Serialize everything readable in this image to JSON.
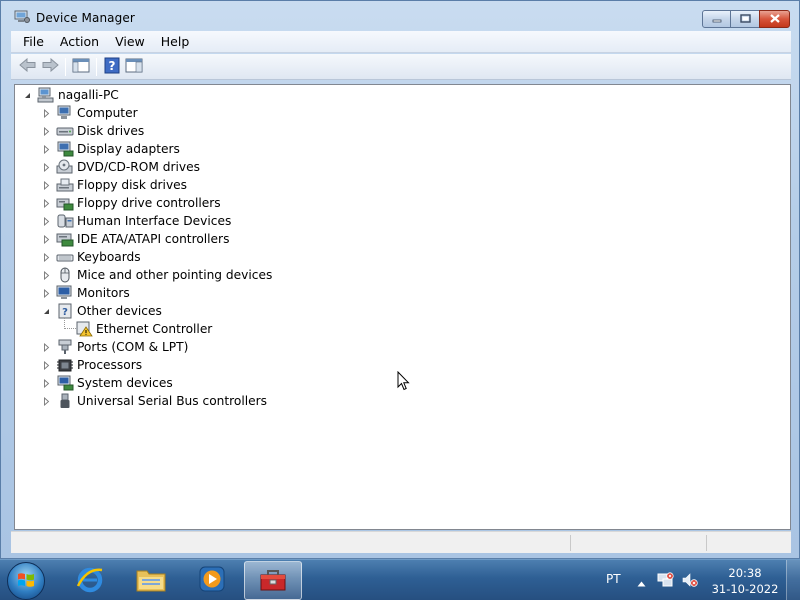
{
  "window": {
    "title": "Device Manager",
    "icon": "device-manager-icon",
    "caption_buttons": [
      "minimize",
      "maximize",
      "close"
    ]
  },
  "menu": [
    "File",
    "Action",
    "View",
    "Help"
  ],
  "toolbar": {
    "buttons": [
      "back-arrow-icon",
      "forward-arrow-icon",
      "show-hide-console-tree-icon",
      "help-icon",
      "show-action-pane-icon"
    ]
  },
  "tree": {
    "root": {
      "label": "nagalli-PC",
      "icon": "computer-network-icon",
      "expanded": true
    },
    "categories": [
      {
        "label": "Computer",
        "icon": "computer-icon",
        "expanded": false
      },
      {
        "label": "Disk drives",
        "icon": "disk-drive-icon",
        "expanded": false
      },
      {
        "label": "Display adapters",
        "icon": "display-adapter-icon",
        "expanded": false
      },
      {
        "label": "DVD/CD-ROM drives",
        "icon": "dvd-drive-icon",
        "expanded": false
      },
      {
        "label": "Floppy disk drives",
        "icon": "floppy-disk-icon",
        "expanded": false
      },
      {
        "label": "Floppy drive controllers",
        "icon": "floppy-controller-icon",
        "expanded": false
      },
      {
        "label": "Human Interface Devices",
        "icon": "hid-icon",
        "expanded": false
      },
      {
        "label": "IDE ATA/ATAPI controllers",
        "icon": "ide-controller-icon",
        "expanded": false
      },
      {
        "label": "Keyboards",
        "icon": "keyboard-icon",
        "expanded": false
      },
      {
        "label": "Mice and other pointing devices",
        "icon": "mouse-icon",
        "expanded": false
      },
      {
        "label": "Monitors",
        "icon": "monitor-icon",
        "expanded": false
      },
      {
        "label": "Other devices",
        "icon": "unknown-device-icon",
        "expanded": true,
        "children": [
          {
            "label": "Ethernet Controller",
            "icon": "warning-device-icon"
          }
        ]
      },
      {
        "label": "Ports (COM & LPT)",
        "icon": "port-icon",
        "expanded": false
      },
      {
        "label": "Processors",
        "icon": "processor-icon",
        "expanded": false
      },
      {
        "label": "System devices",
        "icon": "system-device-icon",
        "expanded": false
      },
      {
        "label": "Universal Serial Bus controllers",
        "icon": "usb-icon",
        "expanded": false
      }
    ]
  },
  "taskbar": {
    "pinned": [
      "internet-explorer-icon",
      "windows-explorer-icon",
      "media-player-icon",
      "toolbox-icon"
    ],
    "active": "toolbox-icon",
    "tray": {
      "language": "PT",
      "icons": [
        "show-hidden-icons-arrow",
        "network-error-icon",
        "volume-muted-icon"
      ]
    },
    "clock": {
      "time": "20:38",
      "date": "31-10-2022"
    }
  },
  "colors": {
    "taskbar": "#2e5f94",
    "window_frame": "#b5cde8",
    "close_button": "#d7553c"
  }
}
